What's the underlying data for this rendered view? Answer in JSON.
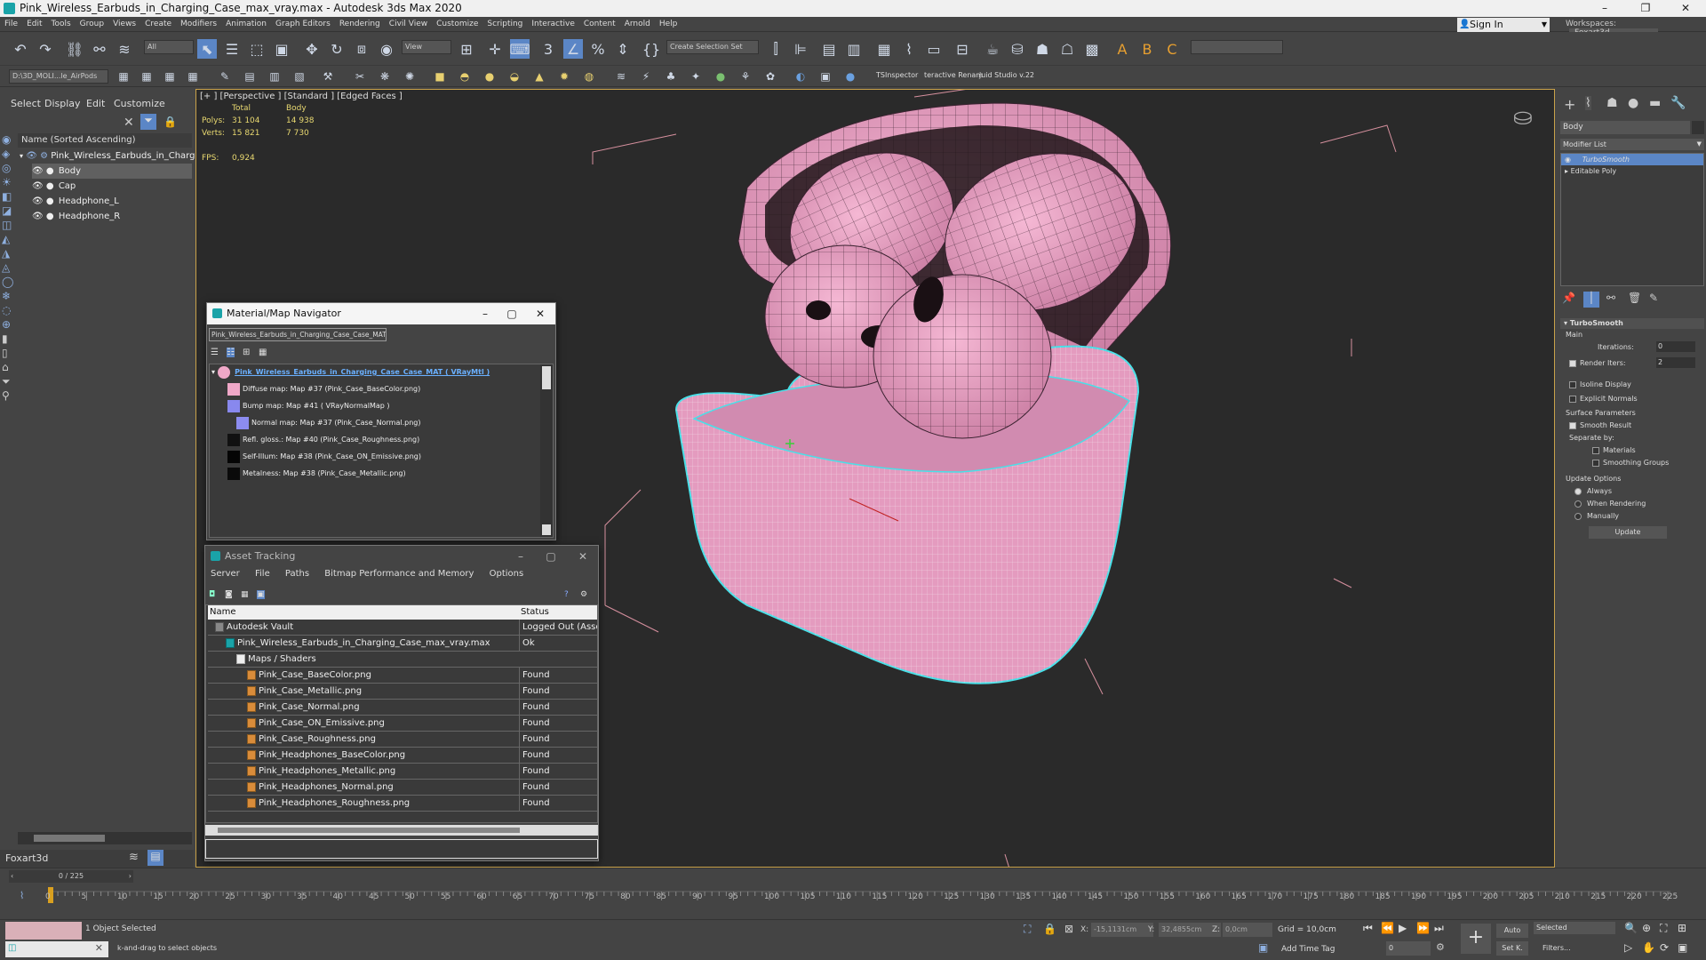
{
  "titlebar": {
    "title": "Pink_Wireless_Earbuds_in_Charging_Case_max_vray.max - Autodesk 3ds Max 2020",
    "minimize": "–",
    "maximize": "❐",
    "close": "✕"
  },
  "menu": [
    "File",
    "Edit",
    "Tools",
    "Group",
    "Views",
    "Create",
    "Modifiers",
    "Animation",
    "Graph Editors",
    "Rendering",
    "Civil View",
    "Customize",
    "Scripting",
    "Interactive",
    "Content",
    "Arnold",
    "Help"
  ],
  "signin": {
    "label": "Sign In"
  },
  "workspace": {
    "label": "Workspaces:",
    "value": "Foxart3d"
  },
  "toolbar": {
    "filter_dropdown": "All",
    "view_dropdown": "View",
    "selection_set": "Create Selection Set",
    "project_path": "D:\\3D_MOLI...le_AirPods",
    "tsinspector": "TSInspector",
    "rename": "teractive Renam",
    "juid": "juid Studio v.22"
  },
  "scene_explorer": {
    "tabs": [
      "Select",
      "Display",
      "Edit",
      "Customize"
    ],
    "sort_header": "Name (Sorted Ascending)",
    "root": "Pink_Wireless_Earbuds_in_Charging_",
    "items": [
      "Body",
      "Cap",
      "Headphone_L",
      "Headphone_R"
    ],
    "layer": "Foxart3d"
  },
  "viewport": {
    "label": "[+ ] [Perspective ] [Standard ] [Edged Faces ]",
    "stats": {
      "col_total": "Total",
      "col_body": "Body",
      "polys_label": "Polys:",
      "polys_total": "31 104",
      "polys_body": "14 938",
      "verts_label": "Verts:",
      "verts_total": "15 821",
      "verts_body": "7 730",
      "fps_label": "FPS:",
      "fps": "0,924"
    },
    "model_color": "#e49bbf",
    "wire_color": "#3a2230",
    "selection_color": "#48e0e8"
  },
  "material_navigator": {
    "title": "Material/Map Navigator",
    "material_field": "Pink_Wireless_Earbuds_in_Charging_Case_Case_MAT",
    "root": "Pink_Wireless_Earbuds_in_Charging_Case_Case_MAT  ( VRayMtl )",
    "maps": [
      {
        "label": "Diffuse map: Map #37 (Pink_Case_BaseColor.png)",
        "color": "#f0a8c8"
      },
      {
        "label": "Bump map: Map #41  ( VRayNormalMap )",
        "color": "#8888ee"
      },
      {
        "label": "Normal map: Map #37 (Pink_Case_Normal.png)",
        "color": "#8c8cf0"
      },
      {
        "label": "Refl. gloss.: Map #40 (Pink_Case_Roughness.png)",
        "color": "#111111"
      },
      {
        "label": "Self-Illum: Map #38 (Pink_Case_ON_Emissive.png)",
        "color": "#050505"
      },
      {
        "label": "Metalness: Map #38 (Pink_Case_Metallic.png)",
        "color": "#0a0a0a"
      }
    ]
  },
  "asset_tracking": {
    "title": "Asset Tracking",
    "menu": [
      "Server",
      "File",
      "Paths",
      "Bitmap Performance and Memory",
      "Options"
    ],
    "col_name": "Name",
    "col_status": "Status",
    "rows": [
      {
        "name": "Autodesk Vault",
        "status": "Logged Out (Asset...",
        "indent": 0
      },
      {
        "name": "Pink_Wireless_Earbuds_in_Charging_Case_max_vray.max",
        "status": "Ok",
        "indent": 1
      },
      {
        "name": "Maps / Shaders",
        "status": "",
        "indent": 2
      },
      {
        "name": "Pink_Case_BaseColor.png",
        "status": "Found",
        "indent": 3
      },
      {
        "name": "Pink_Case_Metallic.png",
        "status": "Found",
        "indent": 3
      },
      {
        "name": "Pink_Case_Normal.png",
        "status": "Found",
        "indent": 3
      },
      {
        "name": "Pink_Case_ON_Emissive.png",
        "status": "Found",
        "indent": 3
      },
      {
        "name": "Pink_Case_Roughness.png",
        "status": "Found",
        "indent": 3
      },
      {
        "name": "Pink_Headphones_BaseColor.png",
        "status": "Found",
        "indent": 3
      },
      {
        "name": "Pink_Headphones_Metallic.png",
        "status": "Found",
        "indent": 3
      },
      {
        "name": "Pink_Headphones_Normal.png",
        "status": "Found",
        "indent": 3
      },
      {
        "name": "Pink_Headphones_Roughness.png",
        "status": "Found",
        "indent": 3
      }
    ]
  },
  "command_panel": {
    "object_name": "Body",
    "modifier_list": "Modifier List",
    "stack": [
      "TurboSmooth",
      "Editable Poly"
    ],
    "rollout_title": "TurboSmooth",
    "main_label": "Main",
    "iterations_label": "Iterations:",
    "iterations": "0",
    "render_iters_label": "Render Iters:",
    "render_iters": "2",
    "isoline": "Isoline Display",
    "explicit_normals": "Explicit Normals",
    "surface_params": "Surface Parameters",
    "smooth_result": "Smooth Result",
    "separate_by": "Separate by:",
    "materials": "Materials",
    "smoothing_groups": "Smoothing Groups",
    "update_options": "Update Options",
    "always": "Always",
    "when_rendering": "When Rendering",
    "manually": "Manually",
    "update_btn": "Update"
  },
  "timeline": {
    "frame_counter": "0 / 225",
    "ticks": [
      "0",
      "5",
      "10",
      "15",
      "20",
      "25",
      "30",
      "35",
      "40",
      "45",
      "50",
      "55",
      "60",
      "65",
      "70",
      "75",
      "80",
      "85",
      "90",
      "95",
      "100",
      "105",
      "110",
      "115",
      "120",
      "125",
      "130",
      "135",
      "140",
      "145",
      "150",
      "155",
      "160",
      "165",
      "170",
      "175",
      "180",
      "185",
      "190",
      "195",
      "200",
      "205",
      "210",
      "215",
      "220",
      "225"
    ]
  },
  "status": {
    "selected": "1 Object Selected",
    "hint": "k-and-drag to select objects",
    "x_label": "X:",
    "x": "-15,1131cm",
    "y_label": "Y:",
    "y": "32,4855cm",
    "z_label": "Z:",
    "z": "0,0cm",
    "grid": "Grid = 10,0cm",
    "add_time_tag": "Add Time Tag",
    "auto": "Auto",
    "selected_dd": "Selected",
    "set_k": "Set K.",
    "filters": "Filters...",
    "frame": "0"
  }
}
